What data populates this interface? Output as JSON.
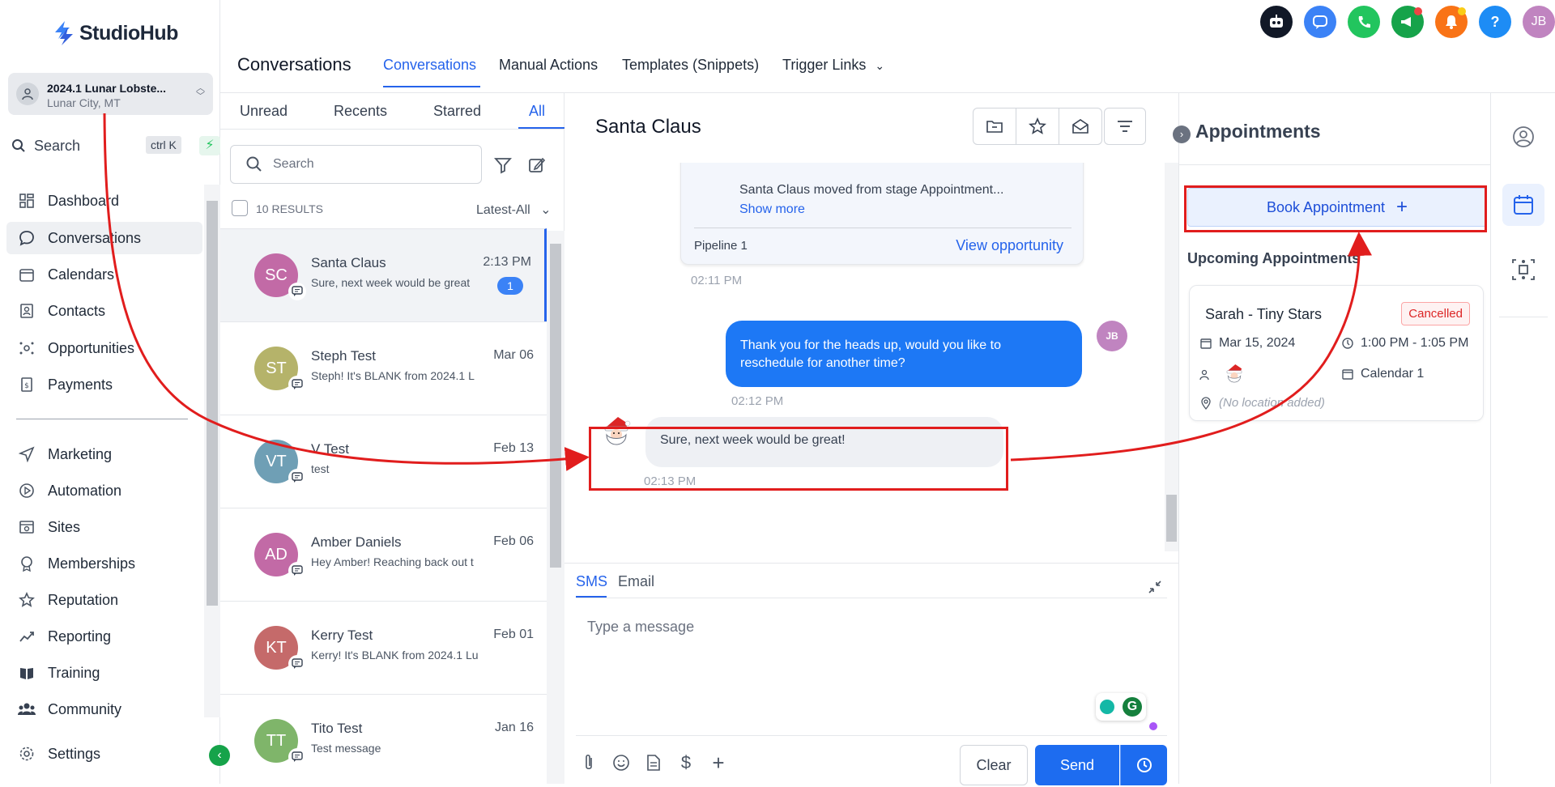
{
  "brand": {
    "name": "StudioHub"
  },
  "location": {
    "name": "2024.1 Lunar Lobste...",
    "sub": "Lunar City, MT"
  },
  "sidebar_search": {
    "label": "Search",
    "shortcut": "ctrl K"
  },
  "nav": [
    {
      "label": "Dashboard",
      "icon": "dashboard-icon"
    },
    {
      "label": "Conversations",
      "icon": "chat-icon"
    },
    {
      "label": "Calendars",
      "icon": "calendar-icon"
    },
    {
      "label": "Contacts",
      "icon": "contacts-icon"
    },
    {
      "label": "Opportunities",
      "icon": "opportunities-icon"
    },
    {
      "label": "Payments",
      "icon": "payments-icon"
    },
    {
      "label": "Marketing",
      "icon": "send-icon"
    },
    {
      "label": "Automation",
      "icon": "automation-icon"
    },
    {
      "label": "Sites",
      "icon": "sites-icon"
    },
    {
      "label": "Memberships",
      "icon": "memberships-icon"
    },
    {
      "label": "Reputation",
      "icon": "star-icon"
    },
    {
      "label": "Reporting",
      "icon": "reporting-icon"
    },
    {
      "label": "Training",
      "icon": "book-icon"
    },
    {
      "label": "Community",
      "icon": "community-icon"
    },
    {
      "label": "Settings",
      "icon": "gear-icon"
    }
  ],
  "header": {
    "title": "Conversations",
    "tabs": [
      "Conversations",
      "Manual Actions",
      "Templates (Snippets)",
      "Trigger Links"
    ],
    "user_initials": "JB",
    "help": "?"
  },
  "list": {
    "filters": [
      "Unread",
      "Recents",
      "Starred",
      "All"
    ],
    "search_placeholder": "Search",
    "results": "10 RESULTS",
    "sort": "Latest-All",
    "conversations": [
      {
        "initials": "SC",
        "name": "Santa Claus",
        "time": "2:13 PM",
        "preview": "Sure, next week would be great",
        "unread": "1",
        "color": "#c26aa6"
      },
      {
        "initials": "ST",
        "name": "Steph Test",
        "time": "Mar 06",
        "preview": "Steph! It's BLANK from 2024.1 L",
        "color": "#b5b36a"
      },
      {
        "initials": "VT",
        "name": "V Test",
        "time": "Feb 13",
        "preview": "test",
        "color": "#6f9fb5"
      },
      {
        "initials": "AD",
        "name": "Amber Daniels",
        "time": "Feb 06",
        "preview": "Hey Amber! Reaching back out t",
        "color": "#c26aa6"
      },
      {
        "initials": "KT",
        "name": "Kerry Test",
        "time": "Feb 01",
        "preview": "Kerry! It's BLANK from 2024.1 Lu",
        "color": "#c56a6a"
      },
      {
        "initials": "TT",
        "name": "Tito Test",
        "time": "Jan 16",
        "preview": "Test message",
        "color": "#7fb56a"
      }
    ]
  },
  "chat": {
    "contact": "Santa Claus",
    "activity": {
      "text": "Santa Claus moved from stage Appointment...",
      "more": "Show more",
      "pipeline": "Pipeline 1",
      "link": "View opportunity"
    },
    "stamp1": "02:11 PM",
    "outgoing": {
      "text": "Thank you for the heads up, would you like to reschedule for another time?",
      "time": "02:12 PM",
      "initials": "JB"
    },
    "incoming": {
      "text": "Sure, next week would be great!",
      "time": "02:13 PM"
    },
    "composer": {
      "tabs": [
        "SMS",
        "Email"
      ],
      "placeholder": "Type a message",
      "clear": "Clear",
      "send": "Send"
    }
  },
  "appointments": {
    "title": "Appointments",
    "book": "Book Appointment",
    "upcoming": "Upcoming Appointments",
    "card": {
      "name": "Sarah - Tiny Stars",
      "status": "Cancelled",
      "date": "Mar 15, 2024",
      "time": "1:00 PM - 1:05 PM",
      "calendar": "Calendar 1",
      "location": "(No location added)"
    }
  },
  "colors": {
    "accent": "#2563eb",
    "annotation": "#e11d1d"
  }
}
